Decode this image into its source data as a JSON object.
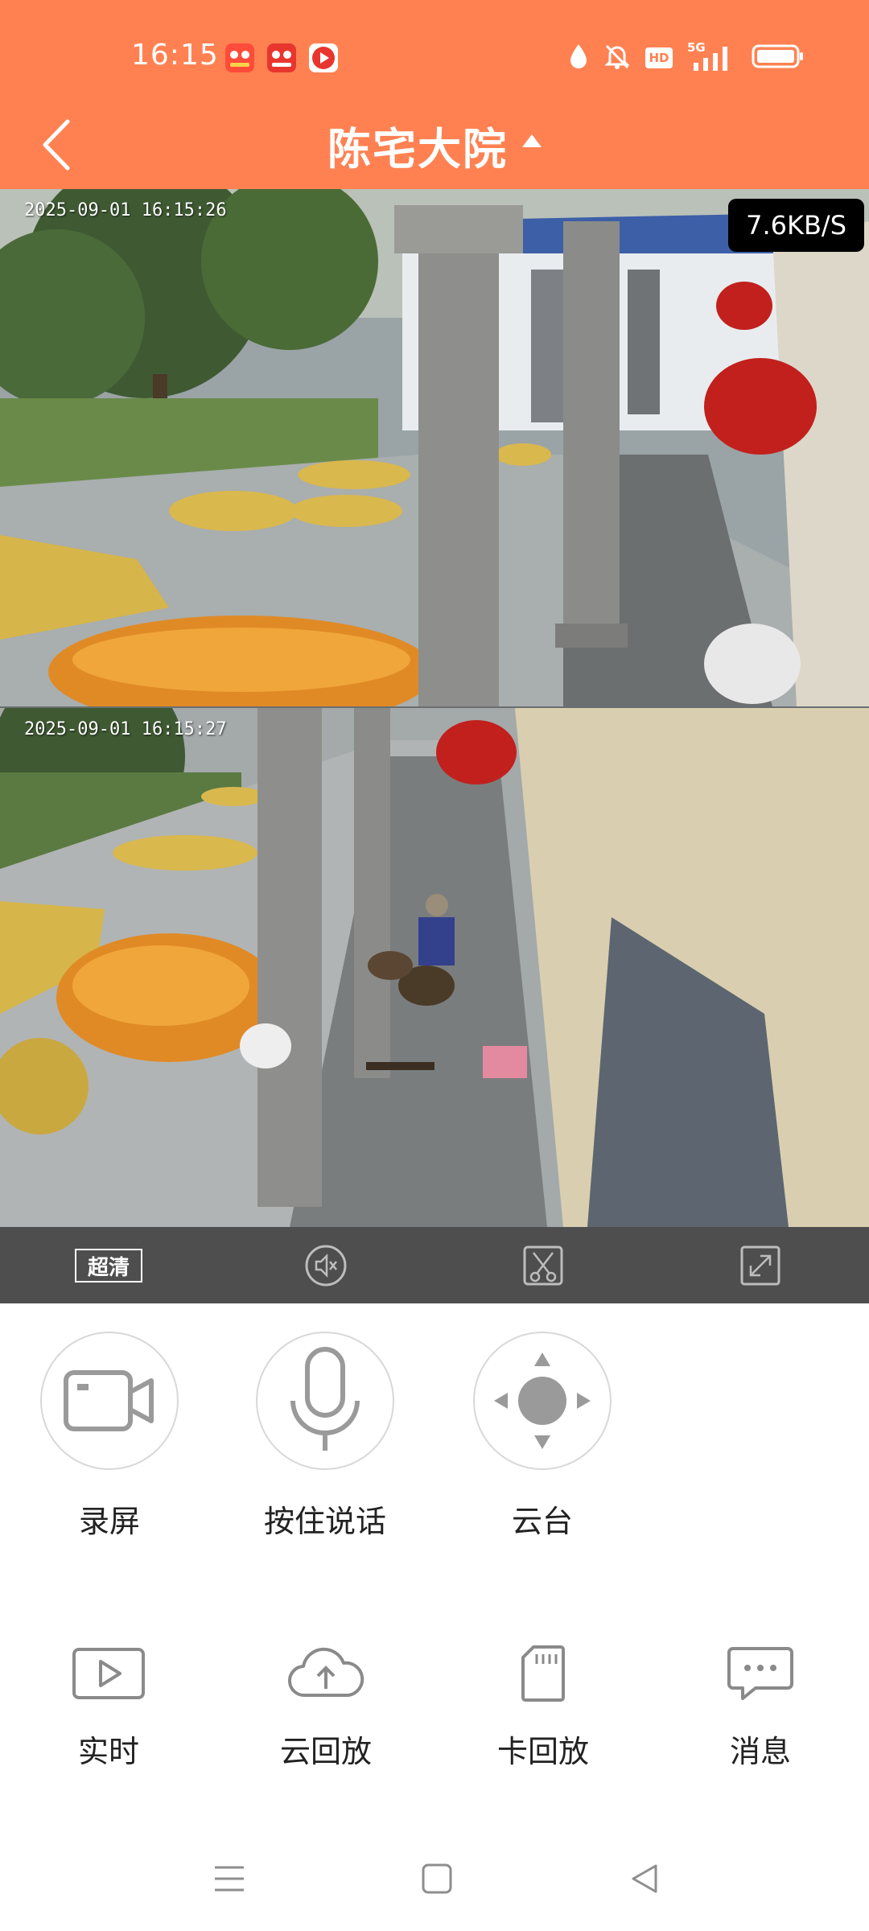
{
  "status_bar": {
    "time": "16:15",
    "apps": [
      "app-icon-red",
      "app-icon-red",
      "youtube-icon"
    ],
    "icons": [
      "water-drop-icon",
      "mute-bell-icon",
      "hd-icon",
      "5g-signal-icon",
      "battery-icon"
    ],
    "hd_text": "HD",
    "network_text": "5G"
  },
  "header": {
    "title": "陈宅大院",
    "back_icon": "chevron-left-icon",
    "dropdown_icon": "caret-up-icon"
  },
  "video": {
    "speed": "7.6KB/S",
    "cameras": [
      {
        "timestamp": "2025-09-01  16:15:26"
      },
      {
        "timestamp": "2025-09-01  16:15:27"
      }
    ]
  },
  "controls": {
    "quality_label": "超清",
    "icons": [
      "quality-icon",
      "mute-speaker-icon",
      "screenshot-scissors-icon",
      "fullscreen-icon"
    ]
  },
  "actions": [
    {
      "label": "录屏",
      "icon": "video-camera-icon"
    },
    {
      "label": "按住说话",
      "icon": "microphone-icon"
    },
    {
      "label": "云台",
      "icon": "ptz-direction-icon"
    }
  ],
  "bottom_nav": [
    {
      "label": "实时",
      "icon": "play-icon"
    },
    {
      "label": "云回放",
      "icon": "cloud-upload-icon"
    },
    {
      "label": "卡回放",
      "icon": "sd-card-icon"
    },
    {
      "label": "消息",
      "icon": "message-icon"
    }
  ],
  "system_nav": [
    "menu-icon",
    "home-icon",
    "back-icon"
  ],
  "colors": {
    "header": "#FF8152",
    "control_bar": "#4e4e4e",
    "text": "#222222"
  }
}
